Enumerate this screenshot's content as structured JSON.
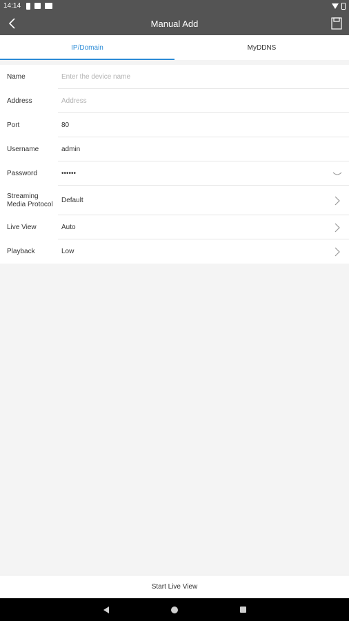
{
  "status_bar": {
    "time": "14:14"
  },
  "app_bar": {
    "title": "Manual Add"
  },
  "tabs": [
    {
      "label": "IP/Domain",
      "active": true
    },
    {
      "label": "MyDDNS",
      "active": false
    }
  ],
  "form": {
    "name": {
      "label": "Name",
      "placeholder": "Enter the device name",
      "value": ""
    },
    "address": {
      "label": "Address",
      "placeholder": "Address",
      "value": ""
    },
    "port": {
      "label": "Port",
      "value": "80"
    },
    "username": {
      "label": "Username",
      "value": "admin"
    },
    "password": {
      "label": "Password",
      "value": "••••••"
    },
    "streaming": {
      "label_line1": "Streaming",
      "label_line2": "Media Protocol",
      "value": "Default"
    },
    "live_view": {
      "label": "Live View",
      "value": "Auto"
    },
    "playback": {
      "label": "Playback",
      "value": "Low"
    }
  },
  "bottom": {
    "start_live_view": "Start Live View"
  },
  "colors": {
    "accent": "#2b8bd6",
    "header": "#545454",
    "background": "#f4f4f4"
  }
}
